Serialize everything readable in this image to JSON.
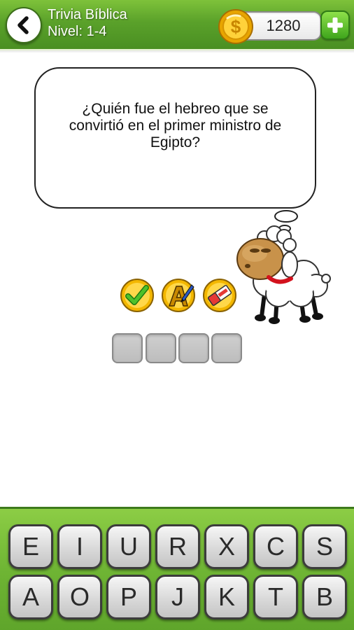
{
  "header": {
    "back_icon": "chevron-left-icon",
    "title": "Trivia Bíblica",
    "level": "Nivel: 1-4",
    "coins": "1280",
    "coin_icon": "dollar-coin-icon",
    "add_icon": "plus-icon"
  },
  "question": {
    "text": "¿Quién fue el hebreo que se convirtió en el primer ministro de Egipto?"
  },
  "powerups": [
    {
      "name": "check-answer",
      "icon": "green-checkmark-icon"
    },
    {
      "name": "reveal-letter",
      "icon": "letter-a-pen-icon"
    },
    {
      "name": "remove-letters",
      "icon": "eraser-icon"
    }
  ],
  "answer": {
    "slot_count": 4,
    "letters": [
      "",
      "",
      "",
      ""
    ]
  },
  "keyboard": {
    "rows": [
      [
        "E",
        "I",
        "U",
        "R",
        "X",
        "C",
        "S"
      ],
      [
        "A",
        "O",
        "P",
        "J",
        "K",
        "T",
        "B"
      ]
    ]
  },
  "colors": {
    "header_green": "#5aa12a",
    "keyboard_green": "#6fb534",
    "coin_gold": "#f2b600",
    "add_green": "#3fa51c",
    "slot_grey": "#c6c6c6",
    "key_grey": "#d9d9d9"
  }
}
